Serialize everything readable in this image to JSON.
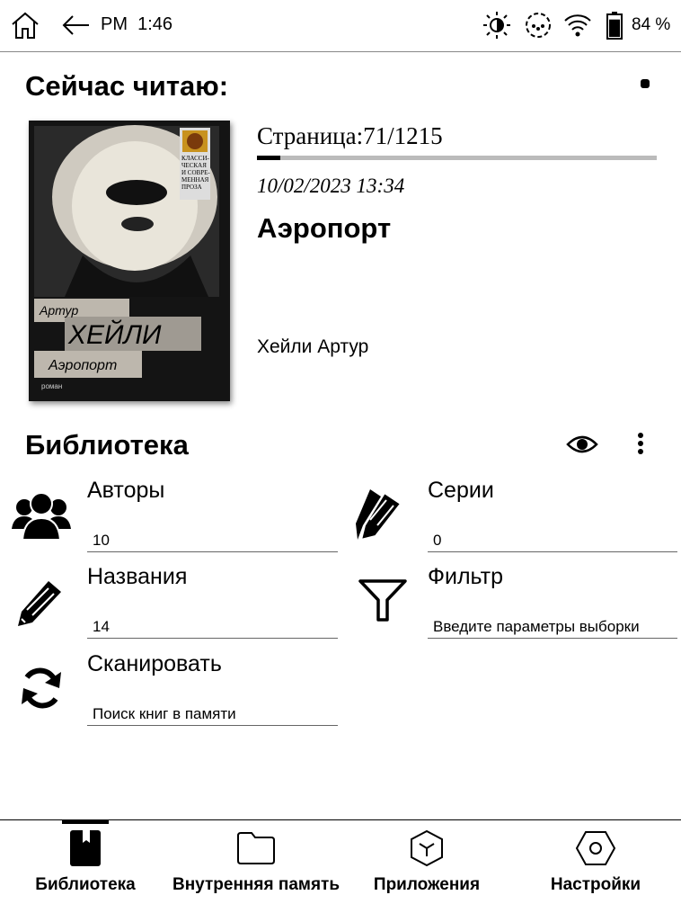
{
  "status_bar": {
    "time": "PM  1:46",
    "battery": "84 %",
    "battery_level": 0.84,
    "icons": [
      "home-icon",
      "back-arrow-icon",
      "brightness-icon",
      "sync-icon",
      "wifi-icon",
      "battery-icon"
    ]
  },
  "current": {
    "heading": "Сейчас читаю:",
    "page_label": "Страница:71/1215",
    "page_current": 71,
    "page_total": 1215,
    "date": "10/02/2023 13:34",
    "title": "Аэропорт",
    "author": "Хейли Артур",
    "cover": {
      "series": "КЛАССИ-ЧЕСКАЯ И СОВРЕ-МЕННАЯ ПРОЗА",
      "author_first": "Артур",
      "author_last": "ХЕЙЛИ",
      "title": "Аэропорт",
      "genre": "роман"
    }
  },
  "library": {
    "heading": "Библиотека",
    "tiles": {
      "authors": {
        "label": "Авторы",
        "value": "10"
      },
      "series": {
        "label": "Серии",
        "value": "0"
      },
      "titles": {
        "label": "Названия",
        "value": "14"
      },
      "filter": {
        "label": "Фильтр",
        "value": "Введите параметры выборки"
      },
      "scan": {
        "label": "Сканировать",
        "value": "Поиск книг в памяти"
      }
    }
  },
  "nav": {
    "library": "Библиотека",
    "storage": "Внутренняя память",
    "apps": "Приложения",
    "settings": "Настройки"
  }
}
